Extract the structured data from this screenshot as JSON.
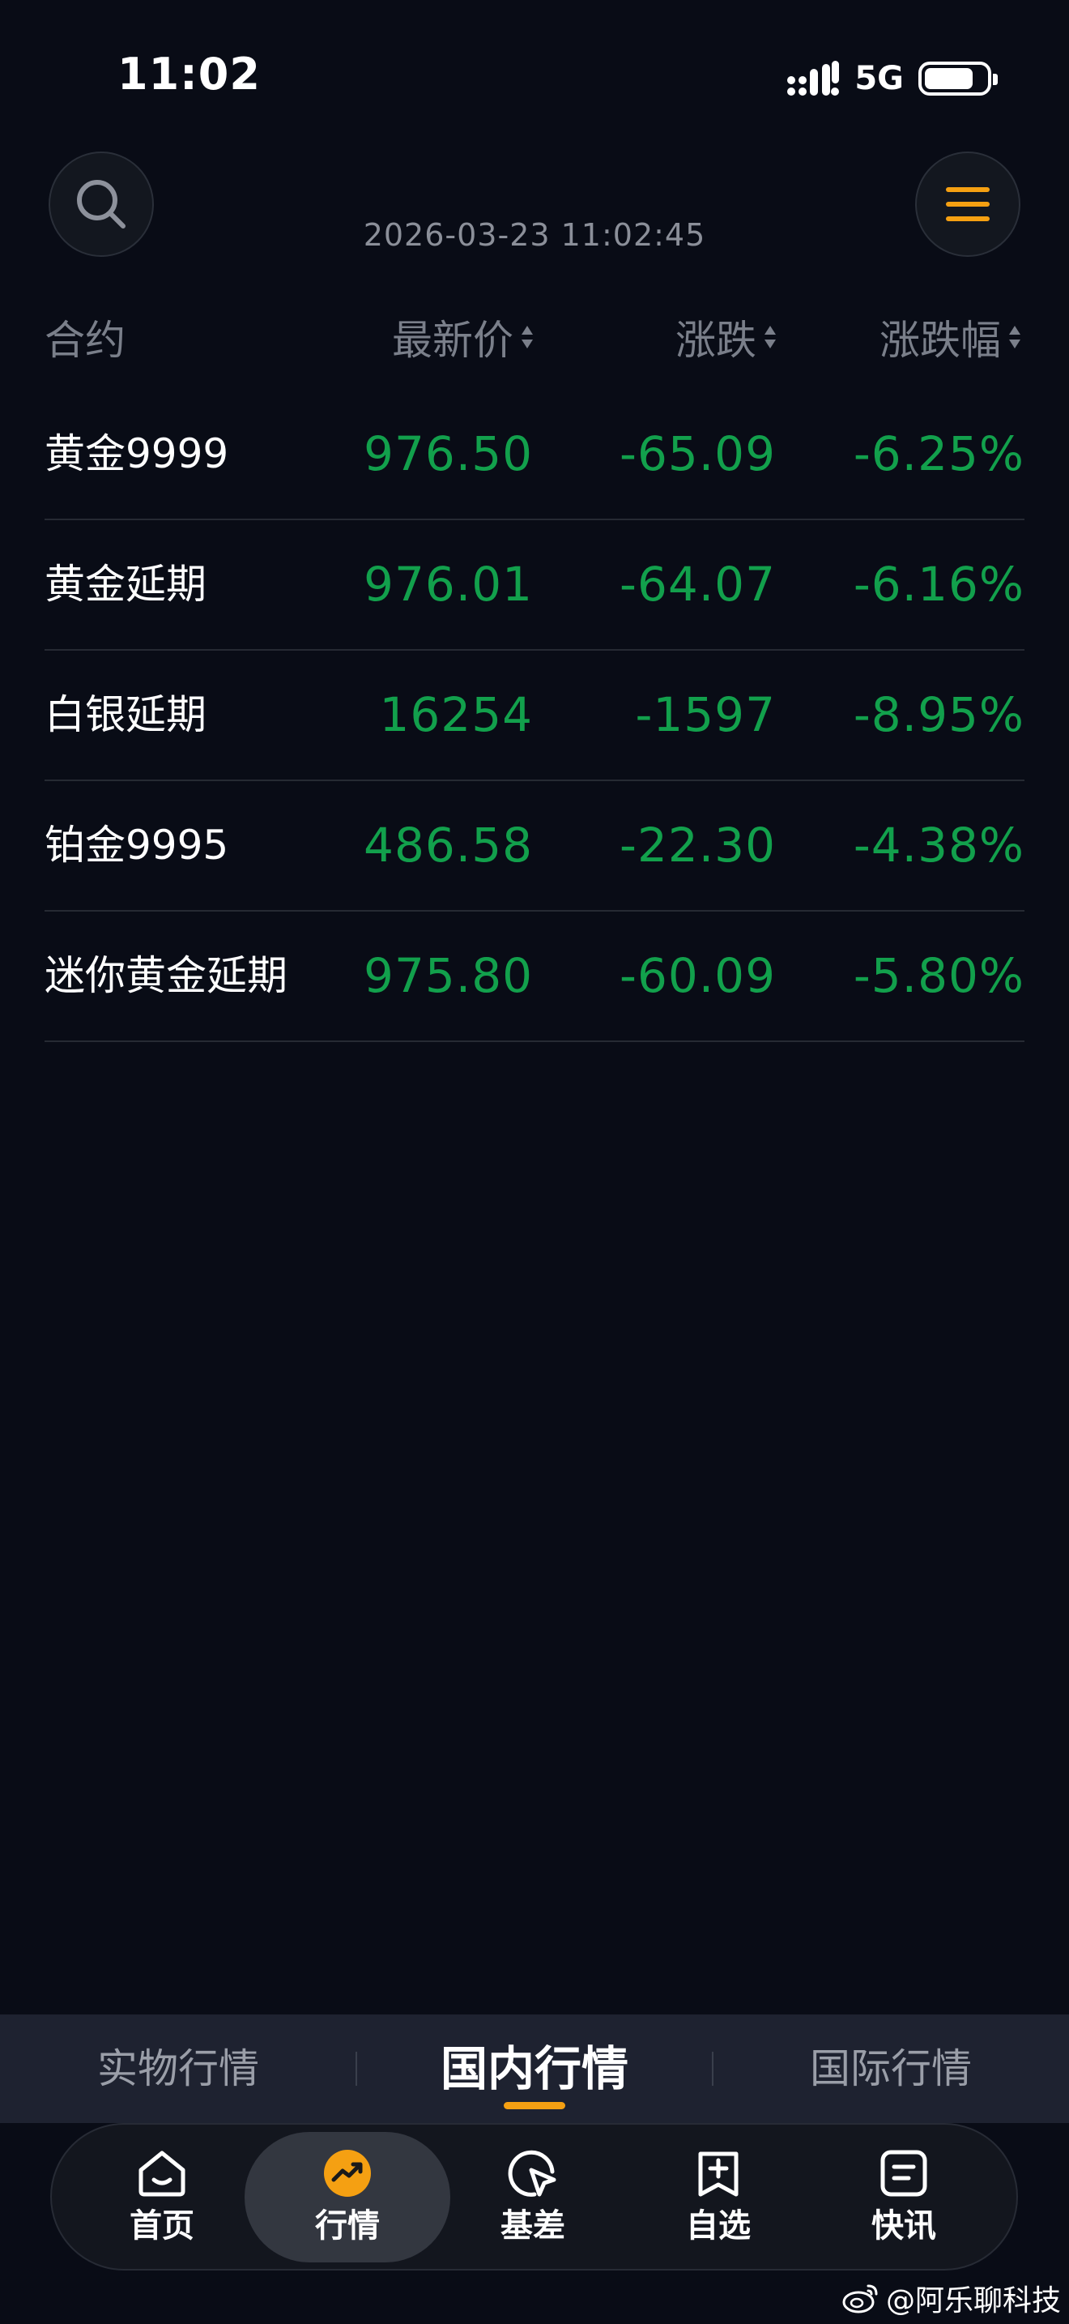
{
  "status_bar": {
    "time": "11:02",
    "network": "5G"
  },
  "header": {
    "timestamp": "2026-03-23 11:02:45"
  },
  "table": {
    "headers": {
      "name": "合约",
      "price": "最新价",
      "change": "涨跌",
      "pct": "涨跌幅"
    },
    "rows": [
      {
        "name": "黄金9999",
        "price": "976.50",
        "change": "-65.09",
        "pct": "-6.25%"
      },
      {
        "name": "黄金延期",
        "price": "976.01",
        "change": "-64.07",
        "pct": "-6.16%"
      },
      {
        "name": "白银延期",
        "price": "16254",
        "change": "-1597",
        "pct": "-8.95%"
      },
      {
        "name": "铂金9995",
        "price": "486.58",
        "change": "-22.30",
        "pct": "-4.38%"
      },
      {
        "name": "迷你黄金延期",
        "price": "975.80",
        "change": "-60.09",
        "pct": "-5.80%"
      }
    ]
  },
  "sub_tabs": [
    {
      "label": "实物行情",
      "active": false
    },
    {
      "label": "国内行情",
      "active": true
    },
    {
      "label": "国际行情",
      "active": false
    }
  ],
  "nav": [
    {
      "label": "首页",
      "icon": "home-icon"
    },
    {
      "label": "行情",
      "icon": "market-trend-icon",
      "active": true
    },
    {
      "label": "基差",
      "icon": "basis-icon"
    },
    {
      "label": "自选",
      "icon": "add-watchlist-icon"
    },
    {
      "label": "快讯",
      "icon": "news-flash-icon"
    }
  ],
  "watermark": "@阿乐聊科技",
  "colors": {
    "background": "#090c16",
    "down": "#12a04c",
    "accent": "#f5a012"
  }
}
